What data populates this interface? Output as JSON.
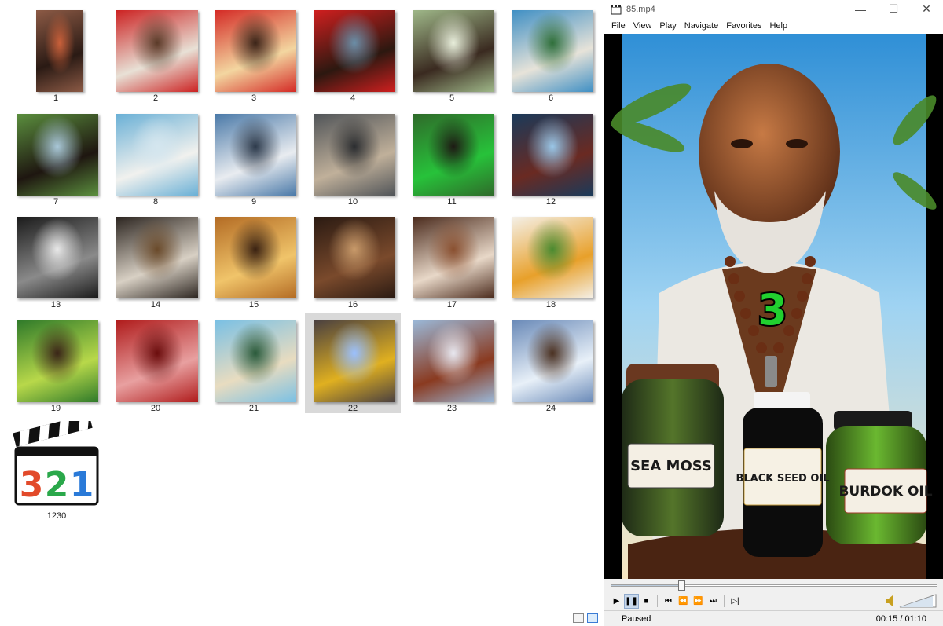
{
  "explorer": {
    "thumbnails": [
      {
        "caption": "1",
        "palette": [
          "#8c5a45",
          "#2a1a14",
          "#c9603a"
        ],
        "portrait": true
      },
      {
        "caption": "2",
        "palette": [
          "#cc2222",
          "#e8e1d6",
          "#5a3a28"
        ]
      },
      {
        "caption": "3",
        "palette": [
          "#d42a25",
          "#f3d6a0",
          "#3b2418"
        ]
      },
      {
        "caption": "4",
        "palette": [
          "#d01f1f",
          "#2c1810",
          "#6b8ea7"
        ]
      },
      {
        "caption": "5",
        "palette": [
          "#9fb889",
          "#3a2a20",
          "#e8eedb"
        ]
      },
      {
        "caption": "6",
        "palette": [
          "#3f8fc4",
          "#e7e3d9",
          "#2f6f3a"
        ]
      },
      {
        "caption": "7",
        "palette": [
          "#5b8f3e",
          "#1e1610",
          "#a9c7d8"
        ]
      },
      {
        "caption": "8",
        "palette": [
          "#6ab0d6",
          "#f1f1ee",
          "#d4e6ef"
        ]
      },
      {
        "caption": "9",
        "palette": [
          "#4a79a8",
          "#e9ecf0",
          "#2d3a4b"
        ]
      },
      {
        "caption": "10",
        "palette": [
          "#505458",
          "#c0b09a",
          "#2b2d30"
        ]
      },
      {
        "caption": "11",
        "palette": [
          "#2f6a2a",
          "#27c23a",
          "#1e1a14"
        ]
      },
      {
        "caption": "12",
        "palette": [
          "#1a3a5a",
          "#6a2a22",
          "#9ac7e8"
        ]
      },
      {
        "caption": "13",
        "palette": [
          "#1a1a1a",
          "#8a8a8a",
          "#e8e8e8"
        ]
      },
      {
        "caption": "14",
        "palette": [
          "#2c2520",
          "#d8d0c4",
          "#6a4a2a"
        ]
      },
      {
        "caption": "15",
        "palette": [
          "#b36b24",
          "#f0c46a",
          "#3a2212"
        ]
      },
      {
        "caption": "16",
        "palette": [
          "#2a1a12",
          "#7a4a2c",
          "#c89a6a"
        ]
      },
      {
        "caption": "17",
        "palette": [
          "#4a2a1c",
          "#e8d8c8",
          "#8a5030"
        ]
      },
      {
        "caption": "18",
        "palette": [
          "#f4f0e8",
          "#e8a02a",
          "#4a8a30"
        ]
      },
      {
        "caption": "19",
        "palette": [
          "#2f7a2a",
          "#b8d84a",
          "#3a2418"
        ]
      },
      {
        "caption": "20",
        "palette": [
          "#b01c1c",
          "#e8a0a0",
          "#6a0c0c"
        ]
      },
      {
        "caption": "21",
        "palette": [
          "#7ac0e4",
          "#e8dcc0",
          "#2a5a3a"
        ]
      },
      {
        "caption": "22",
        "palette": [
          "#4a4040",
          "#e0b020",
          "#9ac0ff"
        ],
        "selected": true
      },
      {
        "caption": "23",
        "palette": [
          "#9ab8d8",
          "#8a3a20",
          "#e8e8f0"
        ]
      },
      {
        "caption": "24",
        "palette": [
          "#6a8ab8",
          "#e8f0f8",
          "#4a3020"
        ]
      }
    ],
    "program_icon": {
      "caption": "1230",
      "digits": [
        "3",
        "2",
        "1"
      ]
    }
  },
  "player": {
    "window_title": "85.mp4",
    "menu": [
      "File",
      "View",
      "Play",
      "Navigate",
      "Favorites",
      "Help"
    ],
    "overlay_number": "3",
    "labels": {
      "left_jar": "SEA MOSS",
      "center_jar": "BLACK SEED OIL",
      "right_jar": "BURDOK OIL"
    },
    "progress": 0.214,
    "volume_icon": "speaker-icon",
    "status": "Paused",
    "time": "00:15 / 01:10"
  },
  "colors": {
    "accent": "#3a7bd5",
    "overlay_green": "#21d02f"
  }
}
